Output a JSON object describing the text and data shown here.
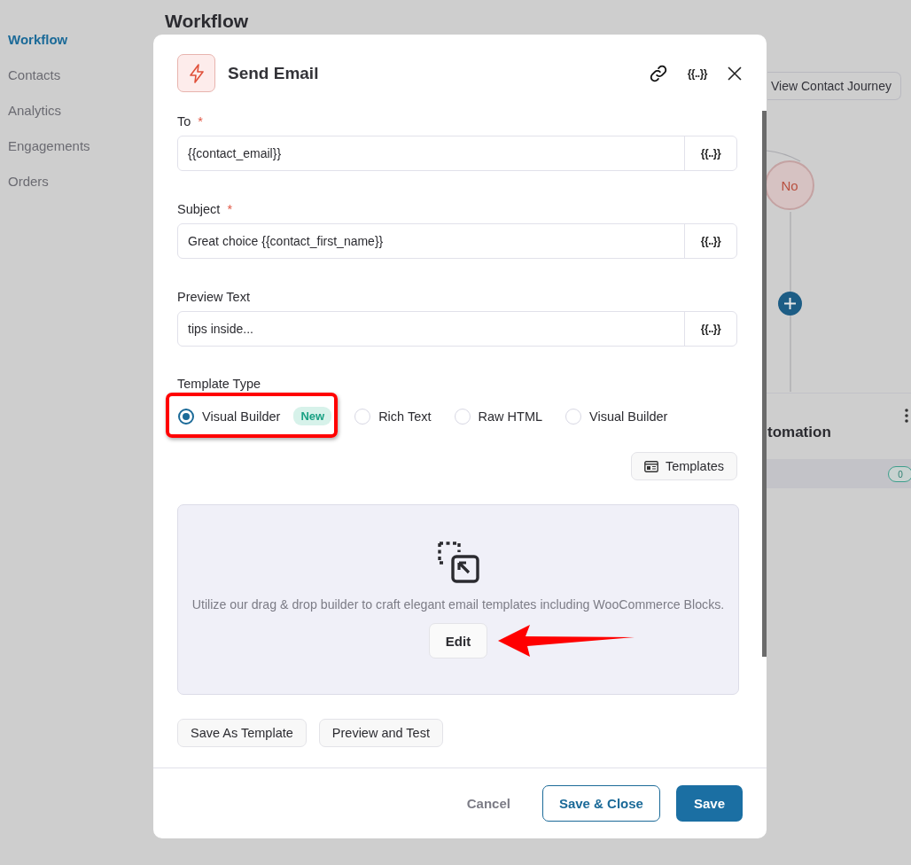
{
  "sidebar": {
    "items": [
      {
        "label": "Workflow",
        "selected": true
      },
      {
        "label": "Contacts",
        "selected": false
      },
      {
        "label": "Analytics",
        "selected": false
      },
      {
        "label": "Engagements",
        "selected": false
      },
      {
        "label": "Orders",
        "selected": false
      }
    ]
  },
  "page": {
    "title": "Workflow",
    "journey_button": "View Contact Journey",
    "branch_node": "No",
    "automation_title": "tomation",
    "count_badge": "0"
  },
  "modal": {
    "title": "Send Email",
    "merge_button": "{{..}}",
    "fields": [
      {
        "label": "To",
        "required_mark": "*",
        "value": "{{contact_email}}",
        "merge_button": "{{..}}"
      },
      {
        "label": "Subject",
        "required_mark": "*",
        "value": "Great choice {{contact_first_name}}",
        "merge_button": "{{..}}"
      },
      {
        "label": "Preview Text",
        "value": "tips inside...",
        "merge_button": "{{..}}"
      }
    ],
    "template_type": {
      "label": "Template Type",
      "options": [
        {
          "label": "Visual Builder",
          "badge": "New",
          "selected": true
        },
        {
          "label": "Rich Text",
          "selected": false
        },
        {
          "label": "Raw HTML",
          "selected": false
        },
        {
          "label": "Visual Builder",
          "selected": false
        }
      ]
    },
    "templates_button": "Templates",
    "builder": {
      "description": "Utilize our drag & drop builder to craft elegant email templates including WooCommerce Blocks.",
      "edit_button": "Edit"
    },
    "actions": [
      "Save As Template",
      "Preview and Test"
    ],
    "footer": {
      "cancel": "Cancel",
      "save_close": "Save & Close",
      "save": "Save"
    }
  }
}
